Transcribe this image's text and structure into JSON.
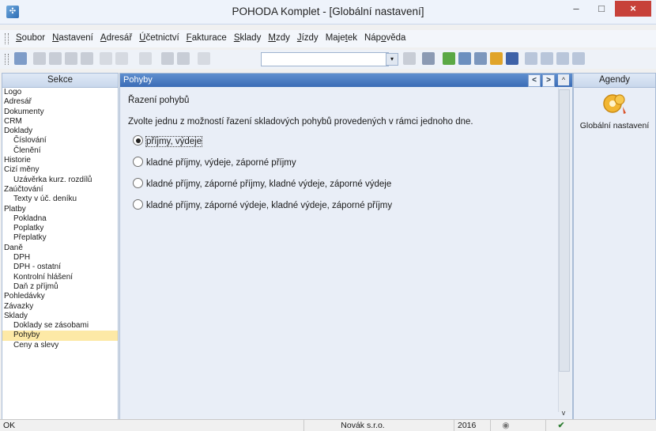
{
  "window": {
    "title": "POHODA Komplet - [Globální nastavení]",
    "minimize": "–",
    "maximize": "□",
    "close": "×"
  },
  "menu": [
    {
      "pre": "",
      "u": "S",
      "post": "oubor"
    },
    {
      "pre": "",
      "u": "N",
      "post": "astavení"
    },
    {
      "pre": "",
      "u": "A",
      "post": "dresář"
    },
    {
      "pre": "",
      "u": "Ú",
      "post": "četnictví"
    },
    {
      "pre": "",
      "u": "F",
      "post": "akturace"
    },
    {
      "pre": "",
      "u": "S",
      "post": "klady"
    },
    {
      "pre": "",
      "u": "M",
      "post": "zdy"
    },
    {
      "pre": "",
      "u": "J",
      "post": "ízdy"
    },
    {
      "pre": "Maje",
      "u": "t",
      "post": "ek"
    },
    {
      "pre": "Náp",
      "u": "o",
      "post": "věda"
    }
  ],
  "sekce": {
    "header": "Sekce",
    "items": [
      {
        "label": "Logo",
        "level": 1
      },
      {
        "label": "Adresář",
        "level": 1
      },
      {
        "label": "Dokumenty",
        "level": 1
      },
      {
        "label": "CRM",
        "level": 1
      },
      {
        "label": "Doklady",
        "level": 1
      },
      {
        "label": "Číslování",
        "level": 2
      },
      {
        "label": "Členění",
        "level": 2
      },
      {
        "label": "Historie",
        "level": 1
      },
      {
        "label": "Cizí měny",
        "level": 1
      },
      {
        "label": "Uzávěrka kurz. rozdílů",
        "level": 2
      },
      {
        "label": "Zaúčtování",
        "level": 1
      },
      {
        "label": "Texty v úč. deníku",
        "level": 2
      },
      {
        "label": "Platby",
        "level": 1
      },
      {
        "label": "Pokladna",
        "level": 2
      },
      {
        "label": "Poplatky",
        "level": 2
      },
      {
        "label": "Přeplatky",
        "level": 2
      },
      {
        "label": "Daně",
        "level": 1
      },
      {
        "label": "DPH",
        "level": 2
      },
      {
        "label": "DPH - ostatní",
        "level": 2
      },
      {
        "label": "Kontrolní hlášení",
        "level": 2
      },
      {
        "label": "Daň z příjmů",
        "level": 2
      },
      {
        "label": "Pohledávky",
        "level": 1
      },
      {
        "label": "Závazky",
        "level": 1
      },
      {
        "label": "Sklady",
        "level": 1
      },
      {
        "label": "Doklady se zásobami",
        "level": 2
      },
      {
        "label": "Pohyby",
        "level": 2,
        "selected": true
      },
      {
        "label": "Ceny a slevy",
        "level": 2
      }
    ]
  },
  "main": {
    "header": "Pohyby",
    "prev": "<",
    "next": ">",
    "scroll_up": "^",
    "scroll_down": "v",
    "title": "Řazení pohybů",
    "description": "Zvolte jednu z možností řazení skladových pohybů provedených v rámci jednoho dne.",
    "options": [
      {
        "label": "příjmy, výdeje",
        "checked": true
      },
      {
        "label": "kladné příjmy, výdeje, záporné příjmy",
        "checked": false
      },
      {
        "label": "kladné příjmy, záporné příjmy, kladné výdeje, záporné výdeje",
        "checked": false
      },
      {
        "label": "kladné příjmy, záporné výdeje, kladné výdeje, záporné příjmy",
        "checked": false
      }
    ]
  },
  "agendy": {
    "header": "Agendy",
    "item_label": "Globální nastavení"
  },
  "status": {
    "left": "OK",
    "company": "Novák s.r.o.",
    "year": "2016"
  }
}
